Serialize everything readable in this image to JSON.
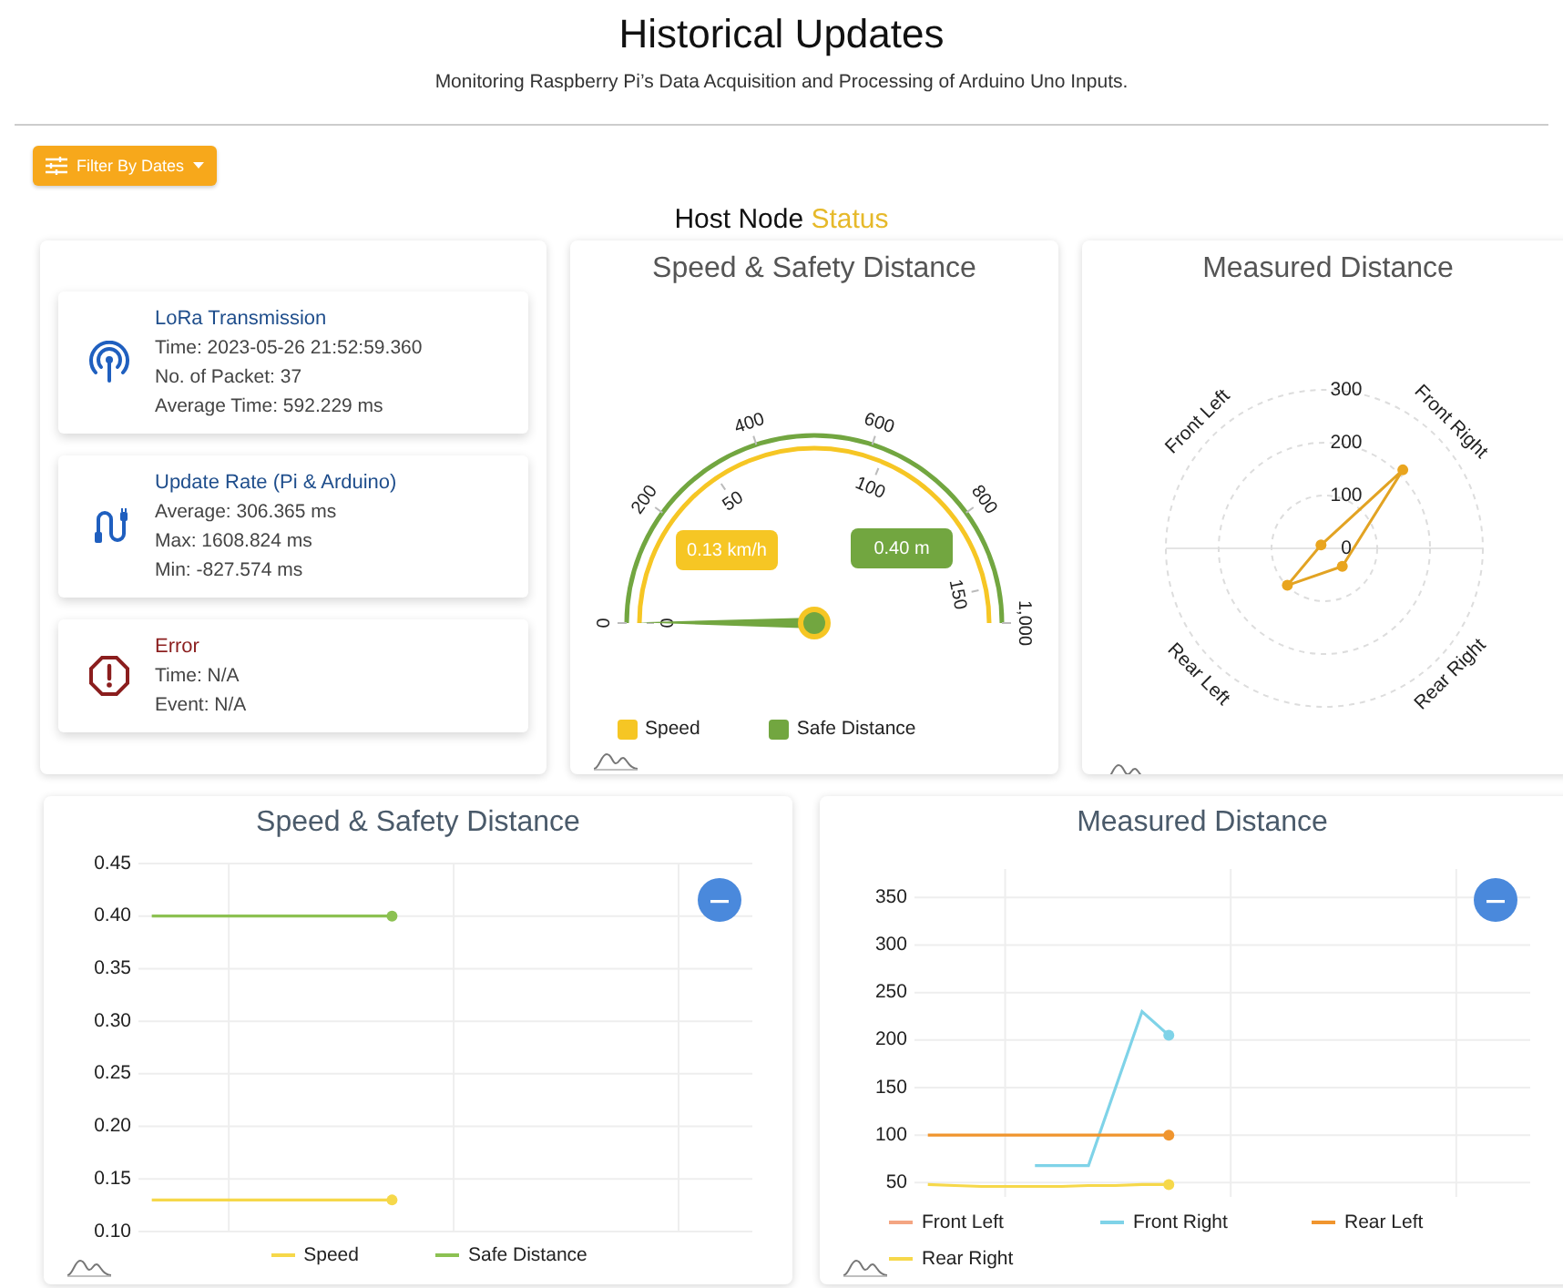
{
  "header": {
    "title": "Historical Updates",
    "subtitle": "Monitoring Raspberry Pi’s Data Acquisition and Processing of Arduino Uno Inputs."
  },
  "filter_button": {
    "label": "Filter By Dates"
  },
  "section_heading": {
    "text": "Host Node",
    "accent": "Status"
  },
  "status_panel": [
    {
      "kind": "transmission",
      "title": "LoRa Transmission",
      "lines": [
        "Time: 2023-05-26 21:52:59.360",
        "No. of Packet: 37",
        "Average Time: 592.229 ms"
      ]
    },
    {
      "kind": "rate",
      "title": "Update Rate (Pi & Arduino)",
      "lines": [
        "Average: 306.365 ms",
        "Max: 1608.824 ms",
        "Min: -827.574 ms"
      ]
    },
    {
      "kind": "error",
      "title": "Error",
      "lines": [
        "Time: N/A",
        "Event: N/A"
      ]
    }
  ],
  "gauge_card": {
    "title": "Speed & Safety Distance",
    "outer_ticks": [
      "0",
      "200",
      "400",
      "600",
      "800",
      "1,000"
    ],
    "inner_ticks": [
      "0",
      "50",
      "100",
      "150"
    ],
    "readouts": [
      {
        "name": "Speed",
        "value": "0.13 km/h",
        "color": "#f6c624"
      },
      {
        "name": "Safe Distance",
        "value": "0.40 m",
        "color": "#72a640"
      }
    ]
  },
  "radar_card": {
    "title": "Measured Distance",
    "ticks": [
      "300",
      "200",
      "100",
      "0"
    ],
    "axes": [
      {
        "label": "Front Left"
      },
      {
        "label": "Front Right"
      },
      {
        "label": "Rear Right"
      },
      {
        "label": "Rear Left"
      }
    ]
  },
  "history_charts": [
    {
      "chart_data": {
        "type": "line",
        "title": "Speed & Safety Distance",
        "grid": true,
        "categories": [
          null,
          null,
          null,
          null,
          null,
          null,
          null,
          null,
          null,
          null,
          null,
          null,
          null,
          null,
          null,
          null,
          null,
          null,
          null,
          null,
          null,
          null,
          null
        ],
        "ylim": [
          0.1,
          0.45
        ],
        "yticks": [
          {
            "value": 0.45,
            "label": "0.45"
          },
          {
            "value": 0.4,
            "label": "0.40"
          },
          {
            "value": 0.35,
            "label": "0.35"
          },
          {
            "value": 0.3,
            "label": "0.30"
          },
          {
            "value": 0.25,
            "label": "0.25"
          },
          {
            "value": 0.2,
            "label": "0.20"
          },
          {
            "value": 0.15,
            "label": "0.15"
          },
          {
            "value": 0.1,
            "label": "0.10"
          }
        ],
        "series": [
          {
            "name": "Speed",
            "color": "#f6d84a",
            "values": [
              0.13,
              0.13,
              0.13,
              0.13,
              0.13,
              0.13,
              0.13,
              0.13,
              0.13,
              0.13,
              null,
              null,
              null,
              null,
              null,
              null,
              null,
              null,
              null,
              null,
              null,
              null,
              null
            ]
          },
          {
            "name": "Safe Distance",
            "color": "#8cc152",
            "values": [
              0.4,
              0.4,
              0.4,
              0.4,
              0.4,
              0.4,
              0.4,
              0.4,
              0.4,
              0.4,
              null,
              null,
              null,
              null,
              null,
              null,
              null,
              null,
              null,
              null,
              null,
              null,
              null
            ]
          }
        ]
      }
    },
    {
      "chart_data": {
        "type": "line",
        "title": "Measured Distance",
        "grid": true,
        "categories": [
          null,
          null,
          null,
          null,
          null,
          null,
          null,
          null,
          null,
          null,
          null,
          null,
          null,
          null,
          null,
          null,
          null,
          null,
          null,
          null,
          null,
          null,
          null
        ],
        "ylim": [
          35,
          380
        ],
        "yticks": [
          {
            "value": 350,
            "label": "350"
          },
          {
            "value": 300,
            "label": "300"
          },
          {
            "value": 250,
            "label": "250"
          },
          {
            "value": 200,
            "label": "200"
          },
          {
            "value": 150,
            "label": "150"
          },
          {
            "value": 100,
            "label": "100"
          },
          {
            "value": 50,
            "label": "50"
          }
        ],
        "series": [
          {
            "name": "Front Left",
            "color": "#f4a582",
            "values": [
              null,
              null,
              null,
              null,
              null,
              null,
              null,
              null,
              null,
              null,
              null,
              null,
              null,
              null,
              null,
              null,
              null,
              null,
              null,
              null,
              null,
              null,
              null
            ]
          },
          {
            "name": "Front Right",
            "color": "#7fd3e8",
            "values": [
              null,
              null,
              null,
              null,
              68,
              68,
              68,
              149,
              230,
              205,
              null,
              null,
              null,
              null,
              null,
              null,
              null,
              null,
              null,
              null,
              null,
              null,
              null
            ]
          },
          {
            "name": "Rear Left",
            "color": "#f0952e",
            "values": [
              100,
              100,
              100,
              100,
              100,
              100,
              100,
              100,
              100,
              100,
              null,
              null,
              null,
              null,
              null,
              null,
              null,
              null,
              null,
              null,
              null,
              null,
              null
            ]
          },
          {
            "name": "Rear Right",
            "color": "#f6d84a",
            "values": [
              48,
              47,
              46,
              46,
              46,
              46,
              47,
              47,
              48,
              48,
              null,
              null,
              null,
              null,
              null,
              null,
              null,
              null,
              null,
              null,
              null,
              null,
              null
            ]
          }
        ]
      }
    }
  ]
}
